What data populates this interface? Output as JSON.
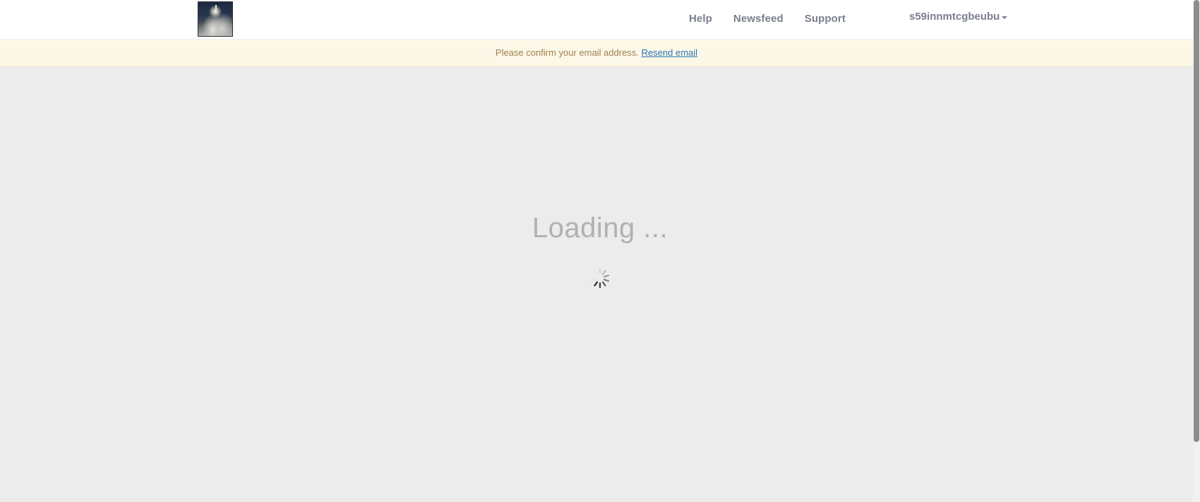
{
  "header": {
    "logo_alt": "rocket-logo",
    "nav": {
      "help": "Help",
      "newsfeed": "Newsfeed",
      "support": "Support"
    },
    "user": {
      "name": "s59innmtcgbeubu"
    }
  },
  "alert": {
    "message": "Please confirm your email address.",
    "link": "Resend email"
  },
  "main": {
    "loading_text": "Loading ..."
  },
  "colors": {
    "alert_bg": "#fcf8e8",
    "alert_text": "#a0804f",
    "link": "#2f74b5",
    "page_bg": "#ececec"
  }
}
